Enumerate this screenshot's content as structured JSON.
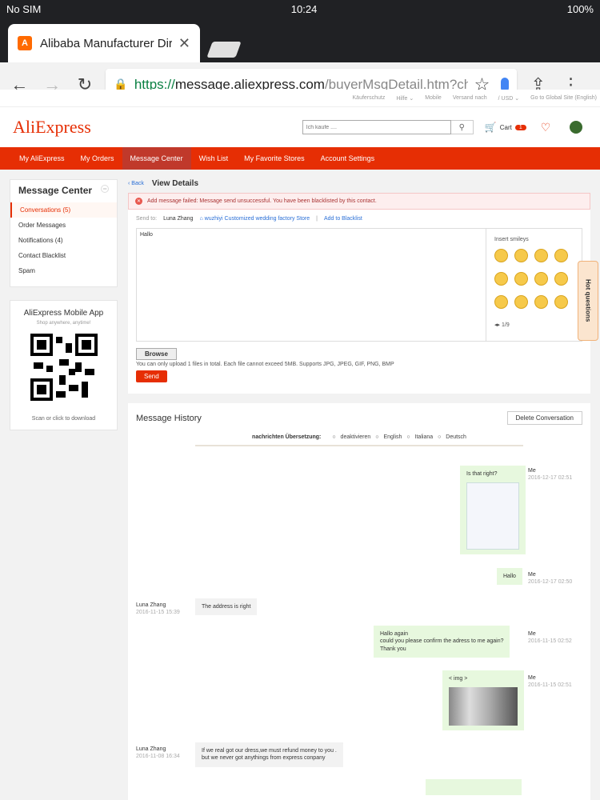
{
  "statusbar": {
    "carrier": "No SIM",
    "time": "10:24",
    "battery": "100%"
  },
  "browser": {
    "tab_title": "Alibaba Manufacturer Direct",
    "url_scheme": "https://",
    "url_host": "message.aliexpress.com",
    "url_path": "/buyerMsgDetail.htm?ch"
  },
  "utilbar": {
    "items": [
      "Käuferschutz",
      "Hilfe ⌄",
      "Mobile",
      "Versand nach",
      "/ USD ⌄",
      "Go to Global Site (English)"
    ]
  },
  "header": {
    "logo_main": "AliExpress",
    "search_placeholder": "Ich kaufe ....",
    "cart_label": "Cart",
    "cart_count": "1"
  },
  "nav": {
    "items": [
      "My AliExpress",
      "My Orders",
      "Message Center",
      "Wish List",
      "My Favorite Stores",
      "Account Settings"
    ]
  },
  "sidebar": {
    "title": "Message Center",
    "items": [
      "Conversations (5)",
      "Order Messages",
      "Notifications (4)",
      "Contact Blacklist",
      "Spam"
    ],
    "app_title": "AliExpress Mobile App",
    "app_sub": "Shop anywhere, anytime!",
    "app_download": "Scan or click to download"
  },
  "main": {
    "back": "Back",
    "title": "View Details",
    "error": "Add message failed: Message send unsuccessful. You have been blacklisted by this contact.",
    "send_to_label": "Send to:",
    "send_to_name": "Luna Zhang",
    "store": "wuzhiyi Customized wedding factory Store",
    "add_blacklist": "Add to Blacklist",
    "editor_text": "Hallo",
    "smileys_label": "Insert smileys",
    "smileys_page": "1/9",
    "browse": "Browse",
    "upload_note": "You can only upload 1 files in total. Each file cannot exceed 5MB. Supports JPG, JPEG, GIF, PNG, BMP",
    "send": "Send"
  },
  "history": {
    "title": "Message History",
    "delete": "Delete Conversation",
    "trans_label": "nachrichten Übersetzung:",
    "trans_options": [
      "deaktivieren",
      "English",
      "Italiana",
      "Deutsch"
    ],
    "messages": [
      {
        "from": "Me",
        "time": "2016-12-17 02:51",
        "text": "Is that right?"
      },
      {
        "from": "Me",
        "time": "2016-12-17 02:50",
        "text": "Hallo"
      },
      {
        "from": "Luna Zhang",
        "time": "2016-11-15 15:39",
        "text": "The address is right"
      },
      {
        "from": "Me",
        "time": "2016-11-15 02:52",
        "text": "Hallo again\ncould you please confirm the adress to me again?\nThank you"
      },
      {
        "from": "Me",
        "time": "2016-11-15 02:51",
        "text": "< img >"
      },
      {
        "from": "Luna Zhang",
        "time": "2016-11-08 16:34",
        "text": "If we real got our dress,we must refund money to you .\nbut we never got anythings from express conpany"
      }
    ]
  },
  "hot_questions": "Hot questions",
  "colors": {
    "brand": "#e62e04",
    "accent": "#f7a325",
    "link": "#2a6fd6"
  }
}
